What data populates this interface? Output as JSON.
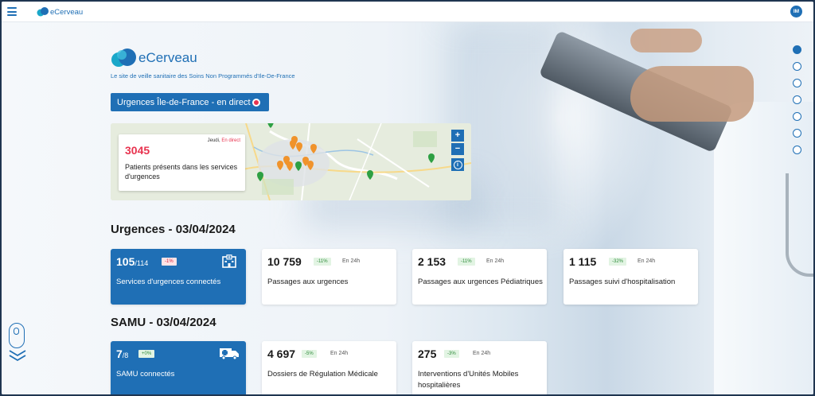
{
  "app": {
    "name": "eCerveau",
    "user_initials": "IM"
  },
  "hero": {
    "brand": "eCerveau",
    "tagline": "Le site de veille sanitaire des Soins Non Programmés d'Ile-De-France",
    "live_button": "Urgences Île-de-France - en direct"
  },
  "map_card": {
    "day": "Jeudi,",
    "live": "En direct",
    "count": "3045",
    "description": "Patients présents dans les services d'urgences",
    "zoom_in": "+",
    "zoom_out": "−",
    "info": "i"
  },
  "urgences": {
    "title": "Urgences - 03/04/2024",
    "cards": [
      {
        "value": "105",
        "sub": "/114",
        "badge": "-1%",
        "label": "Services d'urgences connectés",
        "icon": "hospital-icon"
      },
      {
        "value": "10 759",
        "badge": "-11%",
        "period": "En 24h",
        "label": "Passages aux urgences"
      },
      {
        "value": "2 153",
        "badge": "-11%",
        "period": "En 24h",
        "label": "Passages aux urgences Pédiatriques"
      },
      {
        "value": "1 115",
        "badge": "-32%",
        "period": "En 24h",
        "label": "Passages suivi d'hospitalisation"
      }
    ]
  },
  "samu": {
    "title": "SAMU - 03/04/2024",
    "cards": [
      {
        "value": "7",
        "sub": "/8",
        "badge": "+0%",
        "label": "SAMU connectés",
        "icon": "ambulance-icon"
      },
      {
        "value": "4 697",
        "badge": "-5%",
        "period": "En 24h",
        "label": "Dossiers de Régulation Médicale"
      },
      {
        "value": "275",
        "badge": "-3%",
        "period": "En 24h",
        "label": "Interventions d'Unités Mobiles hospitalières"
      }
    ]
  },
  "nav_dots": {
    "count": 7,
    "active": 0
  },
  "colors": {
    "primary": "#1f6fb5",
    "alert": "#e8334f",
    "marker_orange": "#f0932b",
    "marker_green": "#2ea043"
  }
}
